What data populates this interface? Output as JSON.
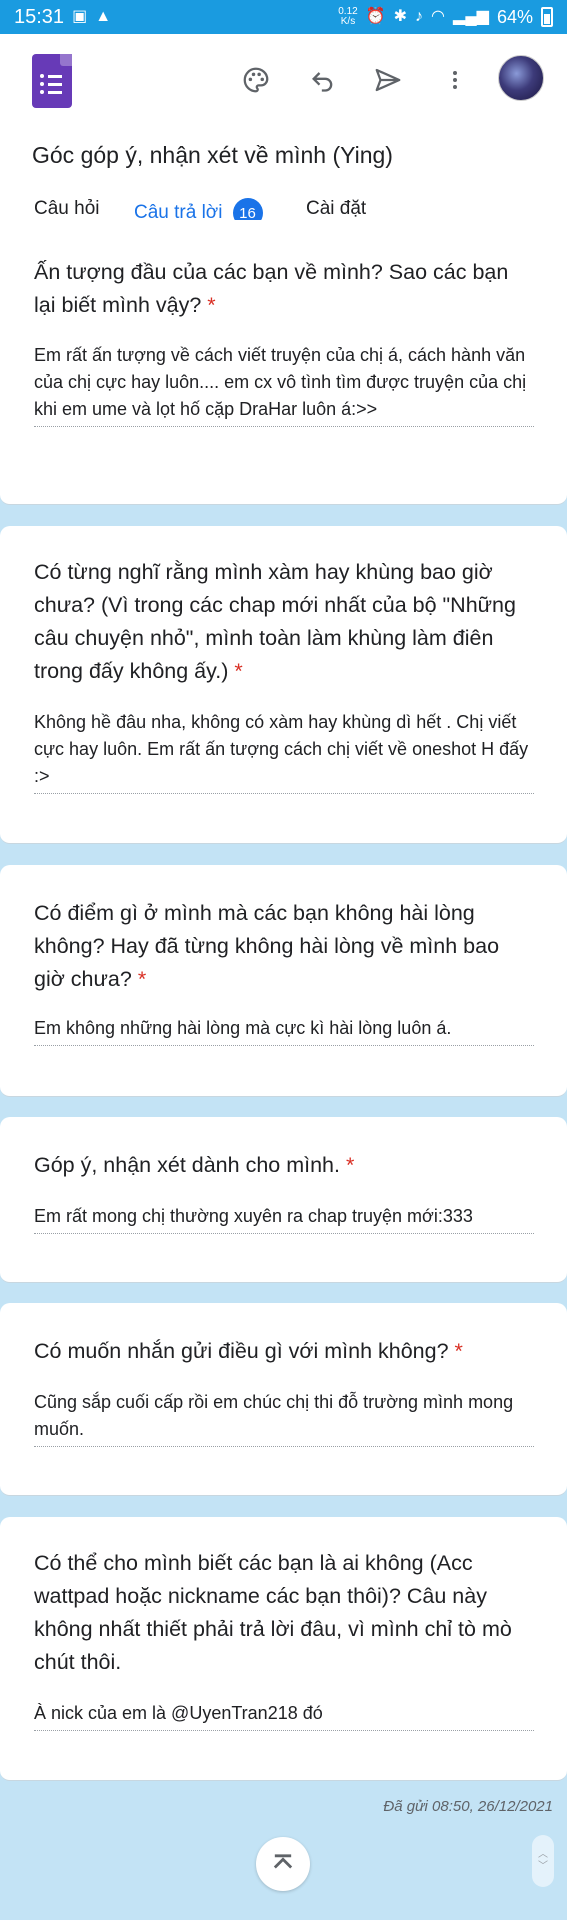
{
  "status_bar": {
    "time": "15:31",
    "speed_value": "0.12",
    "speed_unit": "K/s",
    "battery": "64%",
    "bg_color": "#1a9be0"
  },
  "header": {
    "app_icon": "google-forms-icon",
    "toolbar_icons": [
      "palette-icon",
      "undo-icon",
      "send-icon",
      "more-vert-icon"
    ],
    "form_title": "Góc góp ý, nhận xét về mình (Ying)",
    "tabs": [
      {
        "label": "Câu hỏi"
      },
      {
        "label": "Câu trả lời",
        "badge": "16"
      },
      {
        "label": "Cài đặt"
      }
    ],
    "active_tab": 1,
    "accent_color": "#1a73e8"
  },
  "responses": [
    {
      "question": "Ấn tượng đầu của các bạn về mình? Sao các bạn lại biết mình vậy?",
      "required_mark": "*",
      "answer": "Em rất ấn tượng về cách viết truyện của chị á, cách hành văn của chị cực hay luôn.... em cx vô tình tìm được truyện của chị khi em ume và lọt hố cặp DraHar luôn á:>>"
    },
    {
      "question": "Có từng nghĩ rằng mình xàm hay khùng bao giờ chưa? (Vì trong các chap mới nhất của bộ \"Những câu chuyện nhỏ\", mình toàn làm khùng làm điên trong đấy không ấy.)",
      "required_mark": "*",
      "answer": "Không hề đâu nha, không có xàm hay khùng dì hết . Chị viết cực hay luôn. Em rất ấn tượng cách chị viết về oneshot H đấy :>"
    },
    {
      "question": "Có điểm gì ở mình mà các bạn không hài lòng không? Hay đã từng không hài lòng về mình bao giờ chưa?",
      "required_mark": "*",
      "answer": "Em không những hài lòng mà cực kì hài lòng luôn á."
    },
    {
      "question": "Góp ý, nhận xét dành cho mình.",
      "required_mark": "*",
      "answer": "Em rất mong chị thường xuyên ra chap truyện mới:333"
    },
    {
      "question": "Có muốn nhắn gửi điều gì với mình không?",
      "required_mark": "*",
      "answer": "Cũng sắp cuối cấp rồi em chúc chị thi đỗ trường mình mong muốn."
    },
    {
      "question": "Có thể cho mình biết các bạn là ai không (Acc wattpad hoặc nickname các bạn thôi)? Câu này không nhất thiết phải trả lời đâu, vì mình chỉ tò mò chút thôi.",
      "required_mark": "",
      "answer": "À nick của em là @UyenTran218 đó"
    }
  ],
  "footer": {
    "submitted_at": "Đã gửi 08:50, 26/12/2021",
    "scroll_top_icon": "chevron-up-icon"
  }
}
